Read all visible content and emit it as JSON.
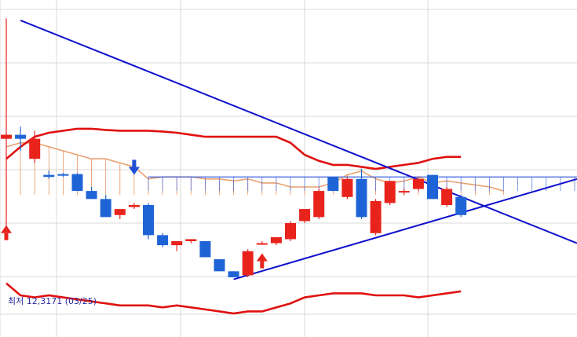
{
  "chart_data": {
    "type": "candlestick",
    "grid": true,
    "x_count": 36,
    "y_range": [
      9.7,
      17.8
    ],
    "colors": {
      "up": "#e8231c",
      "down": "#1f64d6",
      "trendline": "#1010cc",
      "bollinger": "#e01010",
      "cloud_span": "#e8a070",
      "cloud_fill_up": "#e07030",
      "cloud_fill_down": "#3b63e0",
      "grid": "#d8d8d8",
      "signal_up": "#e8231c",
      "signal_down": "#1f4fd6"
    },
    "candles": [
      {
        "i": 0,
        "o": 14.5,
        "h": 17.5,
        "l": 12.3,
        "c": 14.6
      },
      {
        "i": 1,
        "o": 14.6,
        "h": 14.8,
        "l": 14.2,
        "c": 14.5
      },
      {
        "i": 2,
        "o": 14.0,
        "h": 14.7,
        "l": 13.9,
        "c": 14.5
      },
      {
        "i": 3,
        "o": 13.6,
        "h": 13.7,
        "l": 13.5,
        "c": 13.55
      },
      {
        "i": 4,
        "o": 13.62,
        "h": 13.65,
        "l": 13.55,
        "c": 13.58
      },
      {
        "i": 5,
        "o": 13.62,
        "h": 13.65,
        "l": 13.3,
        "c": 13.2
      },
      {
        "i": 6,
        "o": 13.2,
        "h": 13.3,
        "l": 13.0,
        "c": 13.0
      },
      {
        "i": 7,
        "o": 13.0,
        "h": 13.1,
        "l": 12.55,
        "c": 12.55
      },
      {
        "i": 8,
        "o": 12.6,
        "h": 12.7,
        "l": 12.5,
        "c": 12.75
      },
      {
        "i": 9,
        "o": 12.8,
        "h": 12.9,
        "l": 12.75,
        "c": 12.85
      },
      {
        "i": 10,
        "o": 12.85,
        "h": 12.9,
        "l": 12.0,
        "c": 12.1
      },
      {
        "i": 11,
        "o": 12.1,
        "h": 12.15,
        "l": 11.8,
        "c": 11.85
      },
      {
        "i": 12,
        "o": 11.85,
        "h": 11.95,
        "l": 11.7,
        "c": 11.95
      },
      {
        "i": 13,
        "o": 11.95,
        "h": 12.0,
        "l": 11.9,
        "c": 12.0
      },
      {
        "i": 14,
        "o": 11.95,
        "h": 11.95,
        "l": 11.55,
        "c": 11.55
      },
      {
        "i": 15,
        "o": 11.5,
        "h": 11.5,
        "l": 11.2,
        "c": 11.2
      },
      {
        "i": 16,
        "o": 11.2,
        "h": 11.2,
        "l": 11.05,
        "c": 11.05
      },
      {
        "i": 17,
        "o": 11.1,
        "h": 11.75,
        "l": 11.05,
        "c": 11.7
      },
      {
        "i": 18,
        "o": 11.9,
        "h": 11.95,
        "l": 11.9,
        "c": 11.9
      },
      {
        "i": 19,
        "o": 11.9,
        "h": 12.05,
        "l": 11.85,
        "c": 12.05
      },
      {
        "i": 20,
        "o": 12.0,
        "h": 12.45,
        "l": 11.95,
        "c": 12.4
      },
      {
        "i": 21,
        "o": 12.45,
        "h": 12.75,
        "l": 12.4,
        "c": 12.75
      },
      {
        "i": 22,
        "o": 12.55,
        "h": 13.25,
        "l": 12.5,
        "c": 13.2
      },
      {
        "i": 23,
        "o": 13.55,
        "h": 13.55,
        "l": 13.2,
        "c": 13.2
      },
      {
        "i": 24,
        "o": 13.05,
        "h": 13.55,
        "l": 13.0,
        "c": 13.5
      },
      {
        "i": 25,
        "o": 13.5,
        "h": 13.75,
        "l": 12.5,
        "c": 12.55
      },
      {
        "i": 26,
        "o": 12.15,
        "h": 13.0,
        "l": 12.1,
        "c": 12.95
      },
      {
        "i": 27,
        "o": 12.9,
        "h": 13.45,
        "l": 12.85,
        "c": 13.45
      },
      {
        "i": 28,
        "o": 13.2,
        "h": 13.25,
        "l": 13.1,
        "c": 13.2
      },
      {
        "i": 29,
        "o": 13.25,
        "h": 13.55,
        "l": 13.2,
        "c": 13.5
      },
      {
        "i": 30,
        "o": 13.6,
        "h": 13.6,
        "l": 13.0,
        "c": 13.0
      },
      {
        "i": 31,
        "o": 12.85,
        "h": 13.3,
        "l": 12.8,
        "c": 13.25
      },
      {
        "i": 32,
        "o": 13.05,
        "h": 13.1,
        "l": 12.55,
        "c": 12.6
      }
    ],
    "bollinger_upper": [
      14.0,
      14.3,
      14.55,
      14.65,
      14.7,
      14.75,
      14.75,
      14.72,
      14.7,
      14.7,
      14.7,
      14.68,
      14.65,
      14.6,
      14.55,
      14.55,
      14.55,
      14.55,
      14.55,
      14.55,
      14.4,
      14.1,
      13.95,
      13.85,
      13.85,
      13.8,
      13.75,
      13.8,
      13.85,
      13.9,
      14.0,
      14.05,
      14.05
    ],
    "bollinger_lower": [
      10.9,
      10.6,
      10.55,
      10.6,
      10.55,
      10.5,
      10.45,
      10.4,
      10.35,
      10.35,
      10.35,
      10.3,
      10.35,
      10.3,
      10.25,
      10.2,
      10.15,
      10.2,
      10.2,
      10.3,
      10.4,
      10.55,
      10.6,
      10.65,
      10.65,
      10.65,
      10.6,
      10.6,
      10.6,
      10.55,
      10.6,
      10.65,
      10.7
    ],
    "leading_span_top": [
      14.3,
      14.4,
      14.4,
      14.3,
      14.2,
      14.1,
      14.0,
      14.0,
      13.9,
      13.8,
      13.5,
      13.55,
      13.55,
      13.55,
      13.5,
      13.5,
      13.45,
      13.5,
      13.4,
      13.4,
      13.3,
      13.3,
      13.3,
      13.4,
      13.6,
      13.7,
      13.5,
      13.4,
      13.45,
      13.55,
      13.4,
      13.45,
      13.4,
      13.35,
      13.3,
      13.2
    ],
    "min_label": {
      "text": "최저 12,3171 (03/25)",
      "candle": 0
    },
    "signals": [
      {
        "type": "up",
        "i": 0,
        "price": 12.15
      },
      {
        "type": "down",
        "i": 9,
        "price": 13.8
      },
      {
        "type": "up",
        "i": 18,
        "price": 11.45
      },
      {
        "type": "down_wide",
        "i": 0,
        "price": 16.55
      }
    ]
  }
}
